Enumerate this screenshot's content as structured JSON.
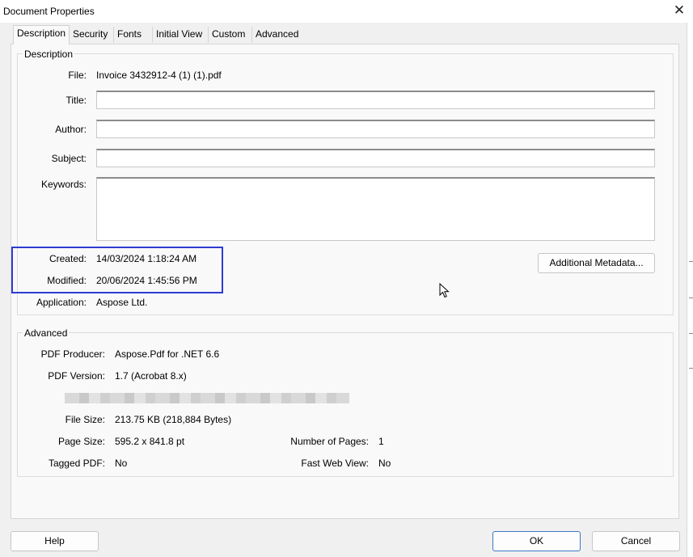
{
  "window": {
    "title": "Document Properties",
    "close_glyph": "✕"
  },
  "tabs": [
    {
      "label": "Description",
      "selected": true
    },
    {
      "label": "Security"
    },
    {
      "label": "Fonts"
    },
    {
      "label": "Initial View"
    },
    {
      "label": "Custom"
    },
    {
      "label": "Advanced"
    }
  ],
  "description": {
    "group_label": "Description",
    "file_label": "File:",
    "file_value": "Invoice 3432912-4 (1) (1).pdf",
    "title_label": "Title:",
    "title_value": "",
    "author_label": "Author:",
    "author_value": "",
    "subject_label": "Subject:",
    "subject_value": "",
    "keywords_label": "Keywords:",
    "keywords_value": "",
    "created_label": "Created:",
    "created_value": "14/03/2024 1:18:24 AM",
    "modified_label": "Modified:",
    "modified_value": "20/06/2024 1:45:56 PM",
    "application_label": "Application:",
    "application_value": "Aspose Ltd.",
    "additional_metadata_label": "Additional Metadata..."
  },
  "advanced": {
    "group_label": "Advanced",
    "producer_label": "PDF Producer:",
    "producer_value": "Aspose.Pdf for .NET 6.6",
    "version_label": "PDF Version:",
    "version_value": "1.7 (Acrobat 8.x)",
    "file_size_label": "File Size:",
    "file_size_value": "213.75 KB (218,884 Bytes)",
    "page_size_label": "Page Size:",
    "page_size_value": "595.2 x 841.8 pt",
    "pages_label": "Number of Pages:",
    "pages_value": "1",
    "tagged_label": "Tagged PDF:",
    "tagged_value": "No",
    "fast_web_label": "Fast Web View:",
    "fast_web_value": "No"
  },
  "buttons": {
    "help": "Help",
    "ok": "OK",
    "cancel": "Cancel"
  },
  "colors": {
    "highlight": "#2e3cd1",
    "ok_border": "#3c79c4"
  }
}
